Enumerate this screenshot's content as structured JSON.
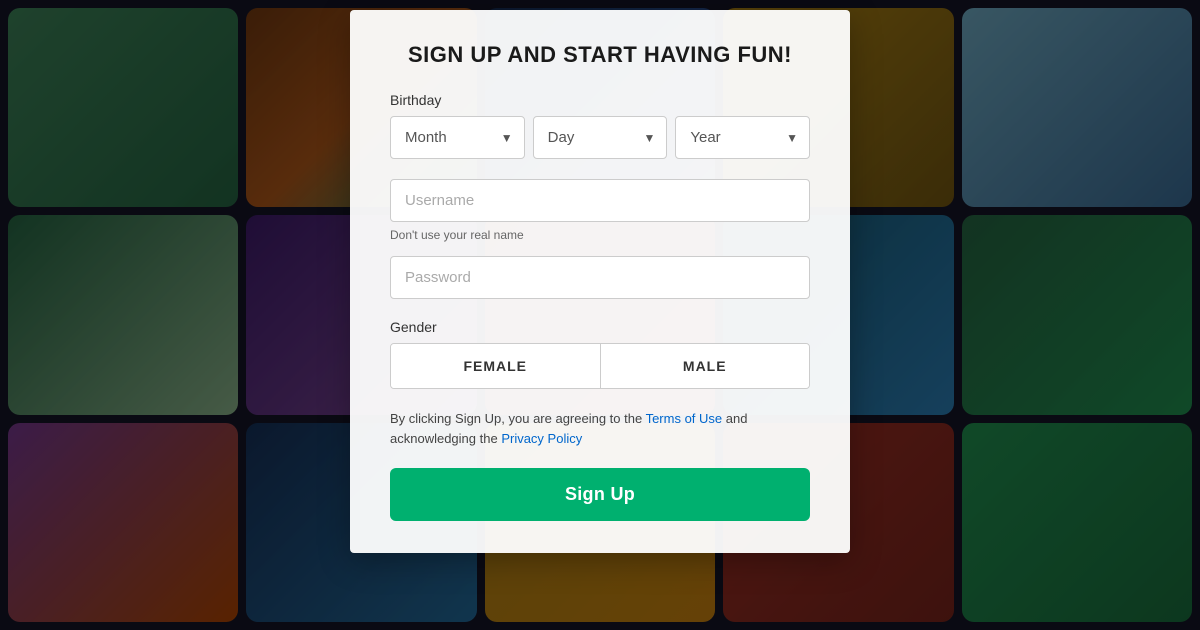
{
  "background": {
    "tiles": [
      {
        "id": 1,
        "class": "bg-tile-1"
      },
      {
        "id": 2,
        "class": "bg-tile-2"
      },
      {
        "id": 3,
        "class": "bg-tile-3"
      },
      {
        "id": 4,
        "class": "bg-tile-4"
      },
      {
        "id": 5,
        "class": "bg-tile-5"
      },
      {
        "id": 6,
        "class": "bg-tile-6"
      },
      {
        "id": 7,
        "class": "bg-tile-7"
      },
      {
        "id": 8,
        "class": "bg-tile-8"
      },
      {
        "id": 9,
        "class": "bg-tile-9"
      },
      {
        "id": 10,
        "class": "bg-tile-10"
      },
      {
        "id": 11,
        "class": "bg-tile-11"
      },
      {
        "id": 12,
        "class": "bg-tile-12"
      },
      {
        "id": 13,
        "class": "bg-tile-13"
      },
      {
        "id": 14,
        "class": "bg-tile-14"
      },
      {
        "id": 15,
        "class": "bg-tile-15"
      }
    ]
  },
  "modal": {
    "title": "SIGN UP AND START HAVING FUN!",
    "birthday_label": "Birthday",
    "month_placeholder": "Month",
    "day_placeholder": "Day",
    "year_placeholder": "Year",
    "username_placeholder": "Username",
    "username_hint": "Don't use your real name",
    "password_placeholder": "Password",
    "gender_label": "Gender",
    "female_label": "FEMALE",
    "male_label": "MALE",
    "terms_prefix": "By clicking Sign Up, you are agreeing to the ",
    "terms_link_text": "Terms of Use",
    "terms_middle": " and acknowledging the ",
    "privacy_link_text": "Privacy Policy",
    "signup_label": "Sign Up",
    "accent_color": "#00b06f",
    "link_color": "#0066cc"
  }
}
